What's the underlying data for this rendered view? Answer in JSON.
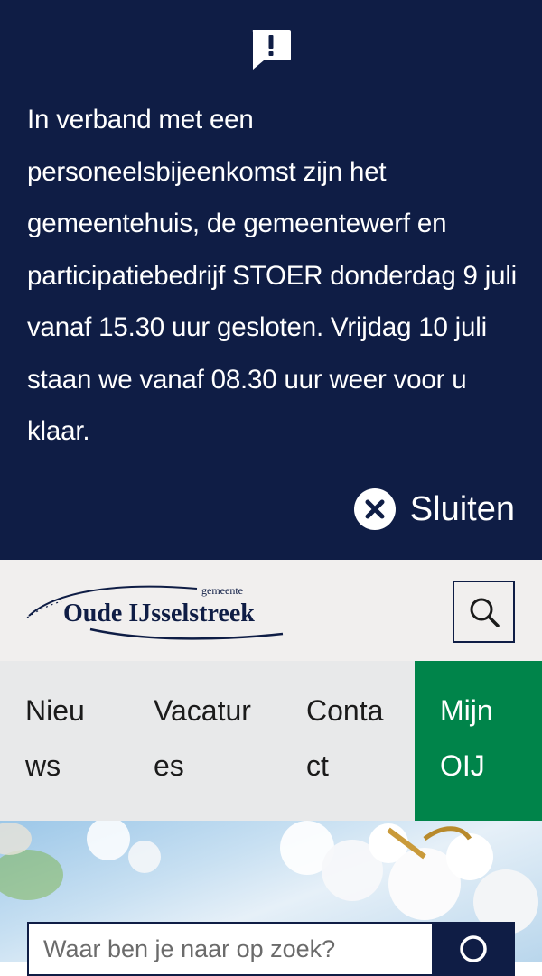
{
  "alert": {
    "icon": "alert-speech-bubble-icon",
    "message": "In verband met een personeelsbijeenkomst zijn het gemeentehuis, de gemeentewerf en participatiebedrijf STOER donderdag 9 juli vanaf 15.30 uur gesloten. Vrijdag 10 juli staan we vanaf 08.30 uur weer voor u klaar.",
    "close_label": "Sluiten",
    "close_icon": "close-circle-icon"
  },
  "header": {
    "logo_prefix": "gemeente",
    "logo_name": "Oude IJsselstreek",
    "search_icon": "search-icon"
  },
  "nav": {
    "items": [
      {
        "label": "Nieuws"
      },
      {
        "label": "Vacatures"
      },
      {
        "label": "Contact"
      },
      {
        "label": "Mijn OIJ"
      }
    ]
  },
  "hero": {
    "search": {
      "placeholder": "Waar ben je naar op zoek?",
      "submit_icon": "search-icon"
    }
  },
  "colors": {
    "alert_bg": "#0f1d45",
    "header_bg": "#f1efee",
    "nav_bg": "#e8e9ea",
    "accent_green": "#00844a"
  }
}
